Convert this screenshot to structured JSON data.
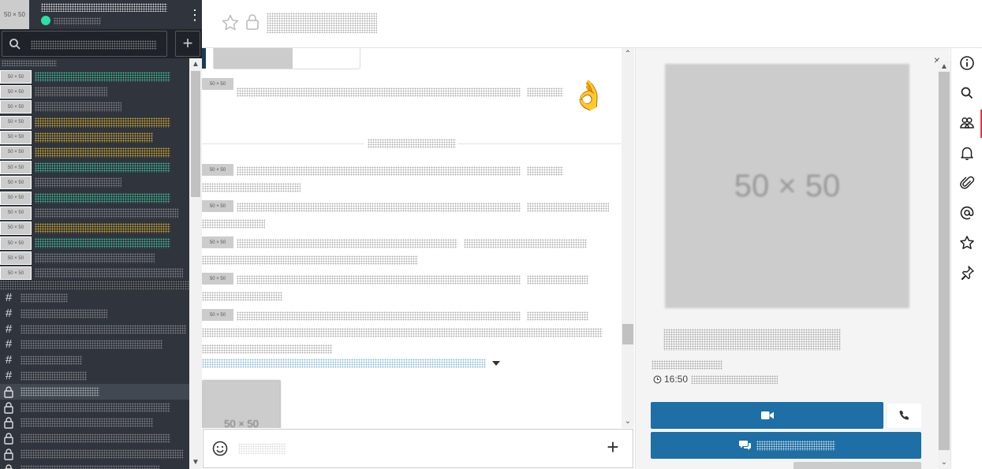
{
  "sidebar": {
    "user_avatar_text": "50 × 50",
    "menu_icon": "kebab-menu-icon",
    "search_icon": "search-icon",
    "add_icon": "plus-icon",
    "direct_messages": [
      {
        "avatar": "50 × 50",
        "color": "green"
      },
      {
        "avatar": "50 × 50",
        "color": "gray"
      },
      {
        "avatar": "50 × 50",
        "color": "gray"
      },
      {
        "avatar": "50 × 50",
        "color": "yellow"
      },
      {
        "avatar": "50 × 50",
        "color": "yellow"
      },
      {
        "avatar": "50 × 50",
        "color": "yellow"
      },
      {
        "avatar": "50 × 50",
        "color": "green"
      },
      {
        "avatar": "50 × 50",
        "color": "gray"
      },
      {
        "avatar": "50 × 50",
        "color": "green"
      },
      {
        "avatar": "50 × 50",
        "color": "gray"
      },
      {
        "avatar": "50 × 50",
        "color": "yellow"
      },
      {
        "avatar": "50 × 50",
        "color": "green"
      },
      {
        "avatar": "50 × 50",
        "color": "gray"
      },
      {
        "avatar": "50 × 50",
        "color": "gray"
      }
    ],
    "channels": [
      {
        "icon": "hash-icon",
        "active": false
      },
      {
        "icon": "hash-icon",
        "active": false
      },
      {
        "icon": "hash-icon",
        "active": false
      },
      {
        "icon": "hash-icon",
        "active": false
      },
      {
        "icon": "hash-icon",
        "active": false
      },
      {
        "icon": "hash-icon",
        "active": false
      },
      {
        "icon": "lock-icon",
        "active": true
      },
      {
        "icon": "lock-icon",
        "active": false
      },
      {
        "icon": "lock-icon",
        "active": false
      },
      {
        "icon": "lock-icon",
        "active": false
      },
      {
        "icon": "lock-icon",
        "active": false
      },
      {
        "icon": "lock-icon",
        "active": false
      }
    ]
  },
  "header": {
    "favorite_icon": "star-outline-icon",
    "private_icon": "lock-icon"
  },
  "messages": {
    "avatar_text": "50 × 50",
    "reaction_emoji": "👌",
    "attachment_text": "50 × 50"
  },
  "composer": {
    "emoji_icon": "smiley-icon",
    "add_icon": "plus-icon"
  },
  "info_panel": {
    "close_icon": "close-icon",
    "profile_image_text": "50 × 50",
    "local_time": "16:50",
    "video_call_icon": "video-camera-icon",
    "phone_icon": "phone-icon",
    "chat_icon": "chat-bubbles-icon"
  },
  "toolbar": {
    "items": [
      "info-icon",
      "search-icon",
      "members-icon",
      "notifications-icon",
      "attachment-icon",
      "mentions-icon",
      "starred-icon",
      "pinned-icon"
    ],
    "active": "members-icon"
  },
  "colors": {
    "sidebar_bg": "#2f343d",
    "primary_button": "#1d6fa5",
    "status_online": "#2de0a5",
    "active_tab_indicator": "#e0364a"
  }
}
